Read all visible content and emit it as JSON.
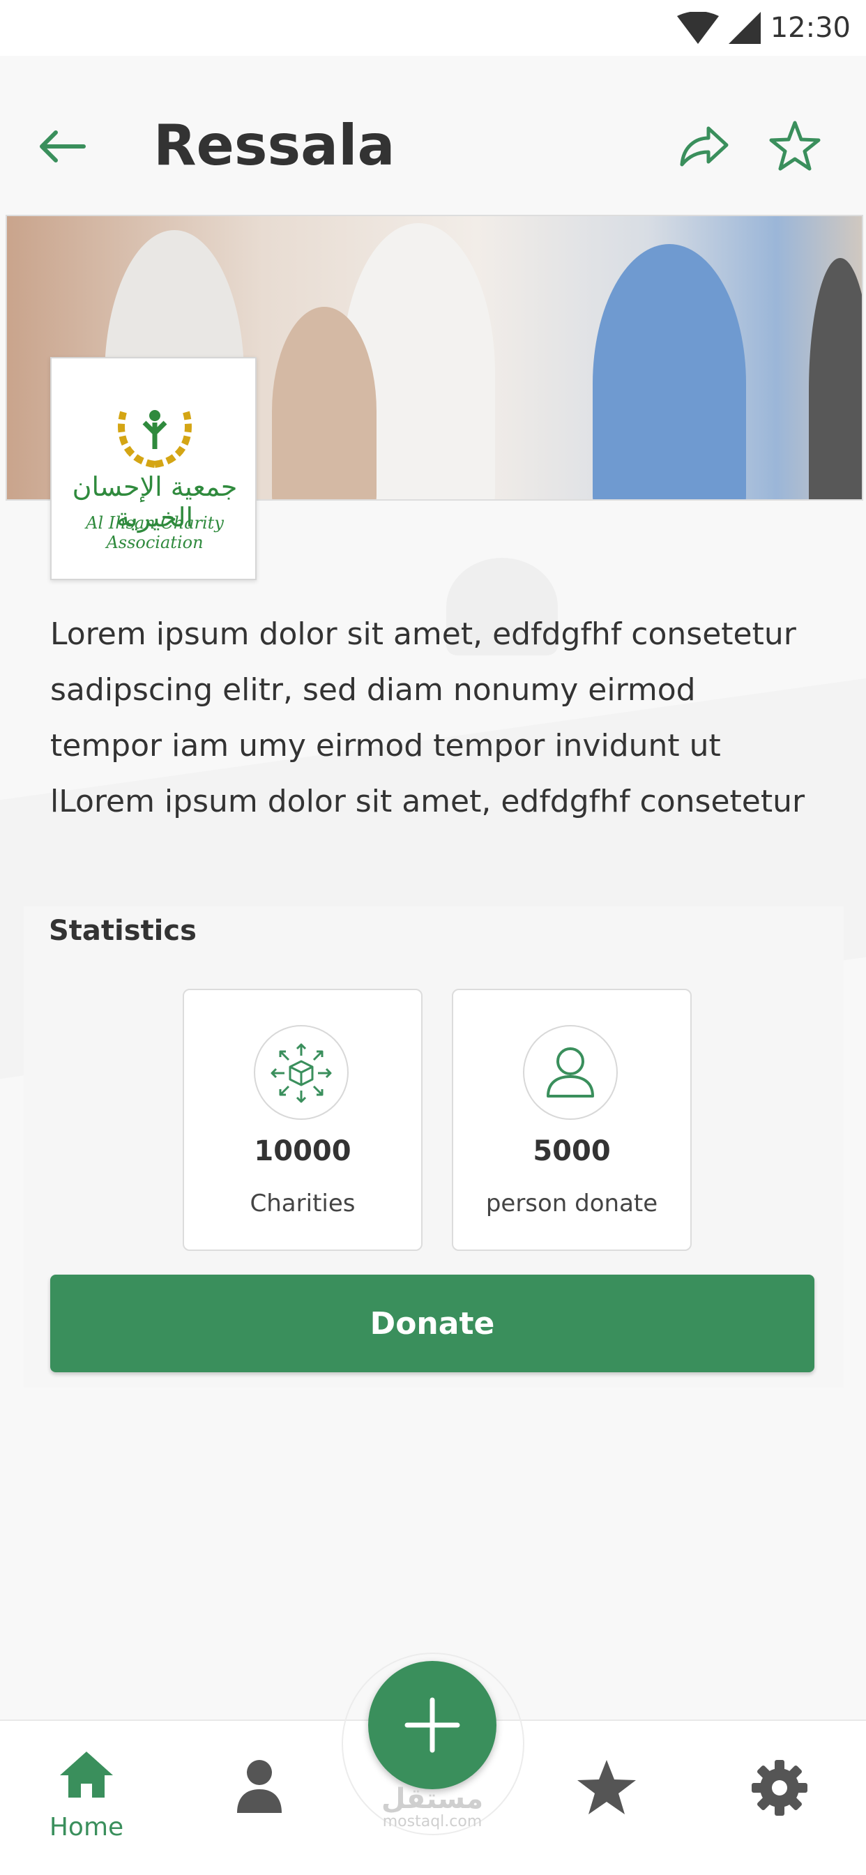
{
  "status_bar": {
    "time": "12:30"
  },
  "app_bar": {
    "title": "Ressala"
  },
  "organization": {
    "logo_arabic": "جمعية الإحسان الخيرية",
    "logo_english": "Al Ihsan Charity Association"
  },
  "description": {
    "lines": [
      "Lorem ipsum dolor sit amet, edfdgfhf consetetur",
      "sadipscing elitr, sed diam nonumy eirmod",
      "tempor iam  umy eirmod tempor invidunt ut",
      "lLorem ipsum dolor sit amet, edfdgfhf consetetur"
    ]
  },
  "statistics": {
    "title": "Statistics",
    "cards": [
      {
        "value": "10000",
        "label": "Charities",
        "icon": "box-distribution-icon"
      },
      {
        "value": "5000",
        "label": "person donate",
        "icon": "user-icon"
      }
    ]
  },
  "donate": {
    "label": "Donate"
  },
  "bottom_nav": {
    "items": [
      {
        "label": "Home",
        "icon": "home-icon",
        "active": true
      },
      {
        "label": "",
        "icon": "profile-icon"
      },
      {
        "label": "",
        "icon": "star-icon"
      },
      {
        "label": "",
        "icon": "gear-icon"
      }
    ]
  },
  "watermark": {
    "arabic": "مستقل",
    "english": "mostaql.com"
  },
  "colors": {
    "accent": "#3a8f5c",
    "text": "#333333",
    "background": "#f8f8f8"
  }
}
